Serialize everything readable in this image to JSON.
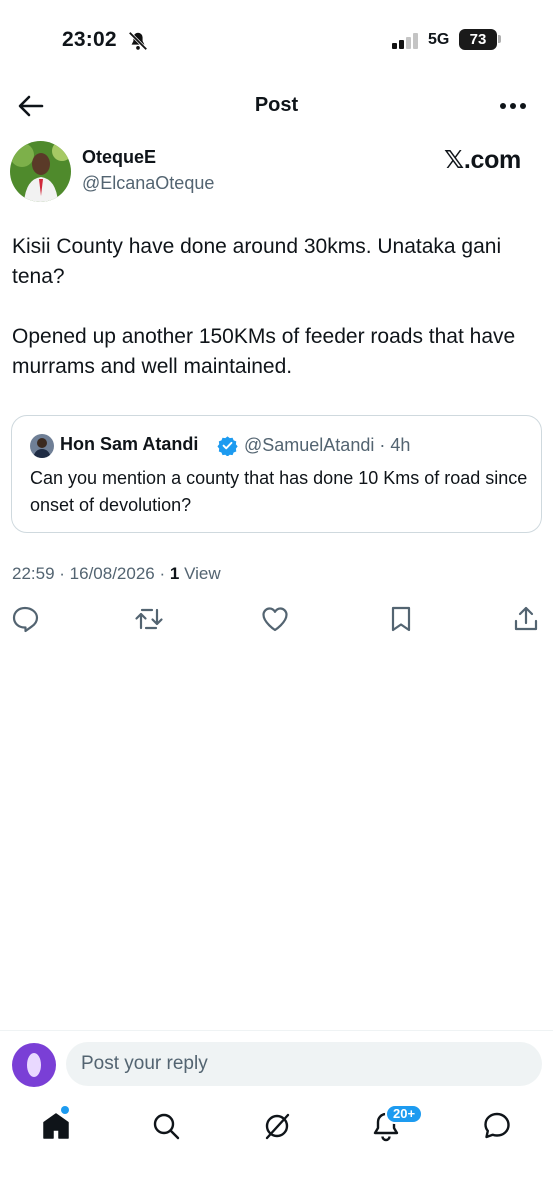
{
  "status_bar": {
    "time": "23:02",
    "network": "5G",
    "battery": "73"
  },
  "nav": {
    "title": "Post"
  },
  "tweet": {
    "author_name": "OtequeE",
    "author_handle": "@ElcanaOteque",
    "watermark": "𝕏.com",
    "paragraphs": [
      "Kisii County have done around 30kms. Unataka gani tena?",
      "Opened up another 150KMs of feeder roads that have murrams and well maintained."
    ],
    "time": "22:59",
    "date": "16/08/2026",
    "views_count": "1",
    "views_label": "View"
  },
  "quote": {
    "author_name": "Hon Sam Atandi",
    "author_handle": "@SamuelAtandi",
    "age": "4h",
    "text": "Can you mention a county that has done 10 Kms of road since onset of devolution?"
  },
  "reply": {
    "placeholder": "Post your reply"
  },
  "tabbar": {
    "notifications_badge": "20+"
  },
  "colors": {
    "accent": "#1d9bf0",
    "text": "#0f1419",
    "muted": "#536471",
    "avatar": "#7a3fd6"
  },
  "icons": [
    "back-arrow-icon",
    "more-icon",
    "verified-icon",
    "reply-icon",
    "repost-icon",
    "like-icon",
    "bookmark-icon",
    "share-icon",
    "home-icon",
    "search-icon",
    "grok-icon",
    "notifications-icon",
    "messages-icon",
    "bell-off-icon",
    "signal-icon"
  ]
}
